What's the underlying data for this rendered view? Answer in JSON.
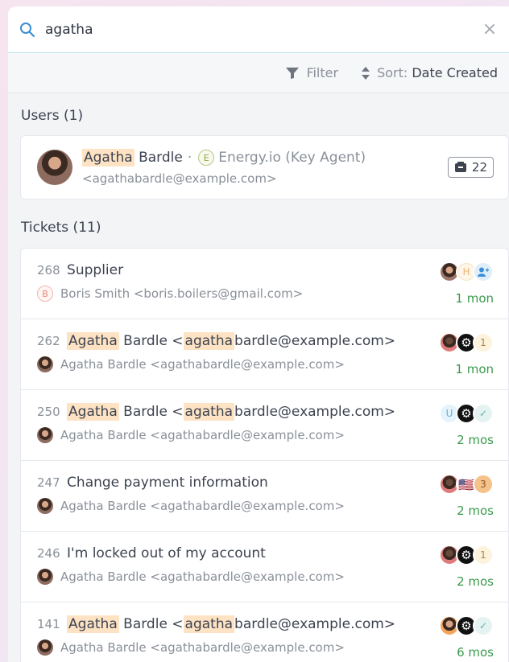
{
  "search": {
    "value": "agatha"
  },
  "toolbar": {
    "filter_label": "Filter",
    "sort_prefix": "Sort:",
    "sort_value": "Date Created"
  },
  "users_section": {
    "title": "Users (1)",
    "user": {
      "first_name": "Agatha",
      "last_name": " Bardle",
      "separator": "·",
      "org_initial": "E",
      "org": "Energy.io (Key Agent)",
      "email": "<agathabardle@example.com>",
      "ticket_count": "22"
    }
  },
  "tickets_section": {
    "title": "Tickets (11)",
    "tickets": [
      {
        "id": "268",
        "subject": "Supplier",
        "requester_initial": "B",
        "requester": "Boris Smith <boris.boilers@gmail.com>",
        "age": "1 mon",
        "chips": [
          "H",
          "agent"
        ]
      },
      {
        "id": "262",
        "hl_a": "Agatha",
        "mid": " Bardle <",
        "hl_b": "agatha",
        "tail": "bardle@example.com>",
        "requester": "Agatha Bardle <agathabardle@example.com>",
        "age": "1 mon",
        "badge": "1"
      },
      {
        "id": "250",
        "hl_a": "Agatha",
        "mid": " Bardle <",
        "hl_b": "agatha",
        "tail": "bardle@example.com>",
        "requester": "Agatha Bardle <agathabardle@example.com>",
        "age": "2 mos",
        "chip_letter": "U"
      },
      {
        "id": "247",
        "subject": "Change payment information",
        "requester": "Agatha Bardle <agathabardle@example.com>",
        "age": "2 mos",
        "badge": "3",
        "flag": "🇺🇸"
      },
      {
        "id": "246",
        "subject": "I'm locked out of my account",
        "requester": "Agatha Bardle <agathabardle@example.com>",
        "age": "2 mos",
        "badge": "1"
      },
      {
        "id": "141",
        "hl_a": "Agatha",
        "mid": " Bardle <",
        "hl_b": "agatha",
        "tail": "bardle@example.com>",
        "requester": "Agatha Bardle <agathabardle@example.com>",
        "age": "6 mos"
      }
    ]
  },
  "icons": {
    "search": "search-icon",
    "clear": "close-icon",
    "filter": "filter-icon",
    "sort": "sort-icon",
    "tickets": "ticket-icon",
    "gear": "gear-icon",
    "check": "check-icon",
    "agent": "agent-icon"
  }
}
